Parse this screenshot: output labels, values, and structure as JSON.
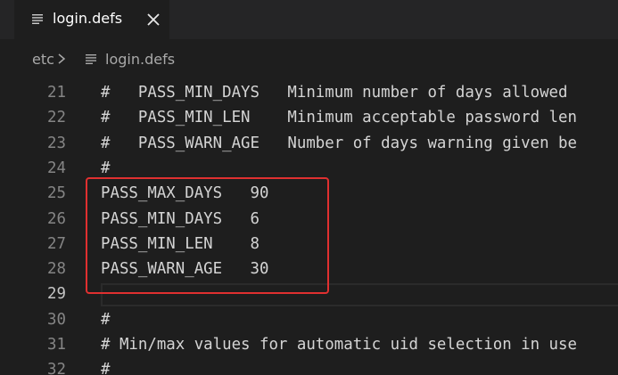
{
  "tab": {
    "label": "login.defs"
  },
  "breadcrumb": {
    "folder": "etc",
    "file": "login.defs"
  },
  "editor": {
    "lines": [
      {
        "num": "21",
        "text": "#   PASS_MIN_DAYS   Minimum number of days allowed"
      },
      {
        "num": "22",
        "text": "#   PASS_MIN_LEN    Minimum acceptable password len"
      },
      {
        "num": "23",
        "text": "#   PASS_WARN_AGE   Number of days warning given be"
      },
      {
        "num": "24",
        "text": "#"
      },
      {
        "num": "25",
        "text": "PASS_MAX_DAYS   90"
      },
      {
        "num": "26",
        "text": "PASS_MIN_DAYS   6"
      },
      {
        "num": "27",
        "text": "PASS_MIN_LEN    8"
      },
      {
        "num": "28",
        "text": "PASS_WARN_AGE   30"
      },
      {
        "num": "29",
        "text": ""
      },
      {
        "num": "30",
        "text": "#"
      },
      {
        "num": "31",
        "text": "# Min/max values for automatic uid selection in use"
      },
      {
        "num": "32",
        "text": "#"
      }
    ],
    "active_line": "29"
  },
  "colors": {
    "annotation": "#e03030",
    "background": "#1e1e1e"
  }
}
